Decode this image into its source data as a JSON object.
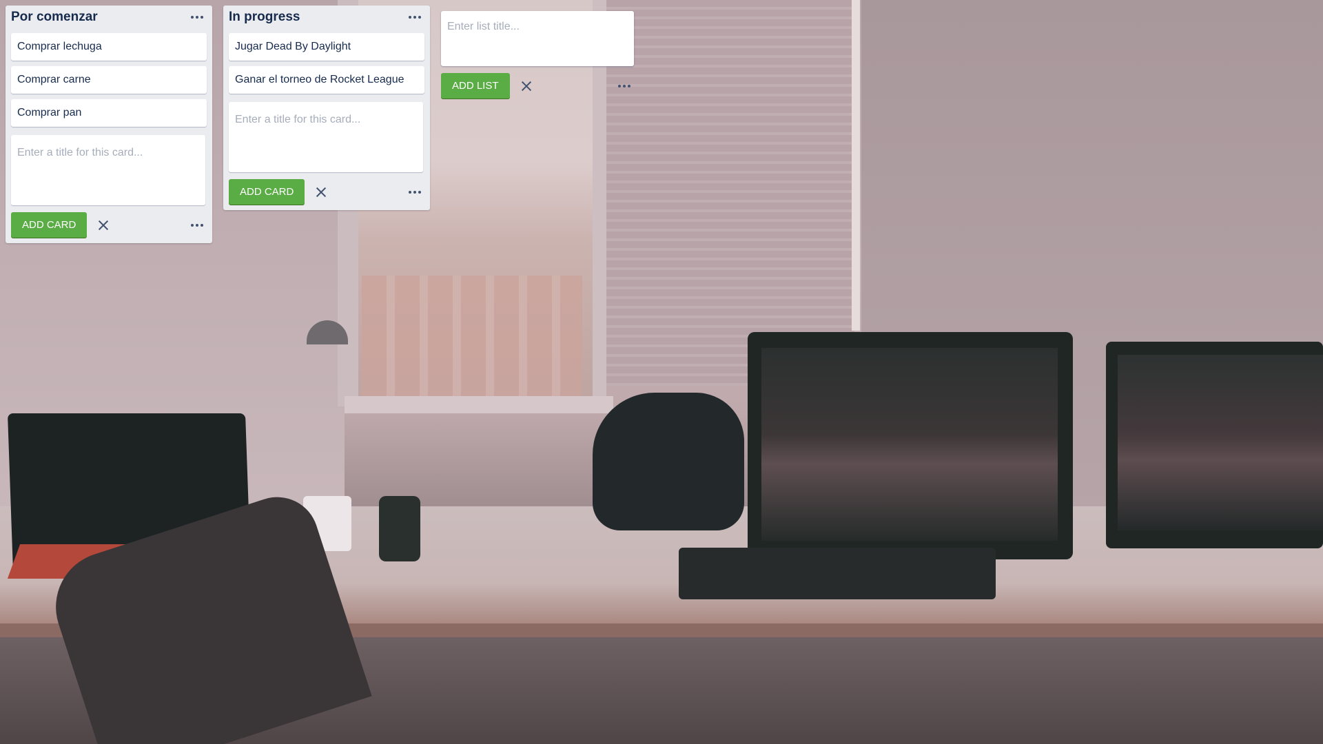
{
  "lists": [
    {
      "title": "Por comenzar",
      "cards": [
        "Comprar lechuga",
        "Comprar carne",
        "Comprar pan"
      ],
      "composer": {
        "placeholder": "Enter a title for this card...",
        "add_label": "ADD CARD"
      }
    },
    {
      "title": "In progress",
      "cards": [
        "Jugar Dead By Daylight",
        "Ganar el torneo de Rocket League"
      ],
      "composer": {
        "placeholder": "Enter a title for this card...",
        "add_label": "ADD CARD"
      }
    }
  ],
  "add_list": {
    "placeholder": "Enter list title...",
    "add_label": "ADD LIST"
  },
  "icons": {
    "menu": "more-horizontal-icon",
    "close": "close-icon"
  },
  "colors": {
    "list_bg": "#ebecf0",
    "button_green": "#5aac44",
    "text": "#172b4d"
  }
}
